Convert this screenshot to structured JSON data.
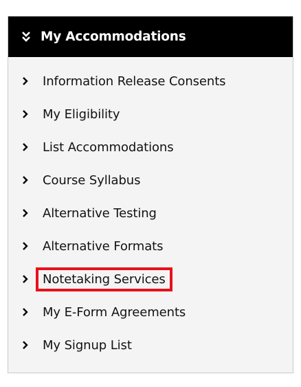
{
  "panel": {
    "title": "My Accommodations",
    "header_icon": "double-chevron-down-icon",
    "item_icon": "chevron-right-icon",
    "highlight_color": "#e8111b",
    "header_background": "#000000",
    "panel_background": "#f4f4f4"
  },
  "menu": {
    "items": [
      {
        "label": "Information Release Consents"
      },
      {
        "label": "My Eligibility"
      },
      {
        "label": "List Accommodations"
      },
      {
        "label": "Course Syllabus"
      },
      {
        "label": "Alternative Testing"
      },
      {
        "label": "Alternative Formats"
      },
      {
        "label": "Notetaking Services",
        "highlighted": true
      },
      {
        "label": "My E-Form Agreements"
      },
      {
        "label": "My Signup List"
      }
    ]
  }
}
